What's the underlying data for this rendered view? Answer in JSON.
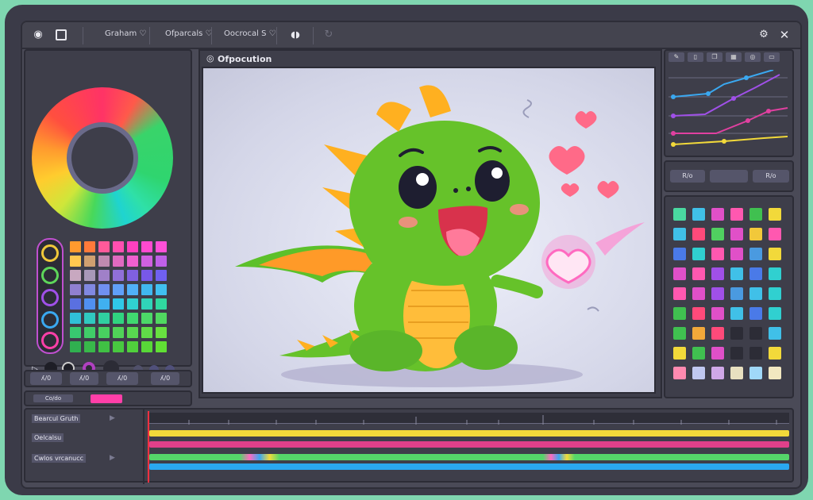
{
  "topbar": {
    "menus": [
      "Graham ♡",
      "Ofparcals ♡",
      "Oocrocal S ♡"
    ],
    "window_controls": [
      "settings-icon",
      "close-icon"
    ]
  },
  "canvas": {
    "title": "Ofpocution"
  },
  "colors": {
    "accent_pink": "#ff3fa8",
    "track_yellow": "#f2d93a",
    "track_magenta": "#e0408a",
    "track_green": "#55d66a",
    "track_blue": "#2aa8f0"
  },
  "left_panel": {
    "buttons": [
      "ʎ/0",
      "ʎ/0",
      "ʎ/0",
      "ʎ/0"
    ],
    "color_label": "Co/do"
  },
  "curves_panel": {
    "buttons": [
      "R/o",
      "",
      "R/o"
    ]
  },
  "timeline": {
    "tracks": [
      "Bearcul Gruth",
      "Oelcalsu",
      "Cwlos vrcanucc"
    ]
  }
}
